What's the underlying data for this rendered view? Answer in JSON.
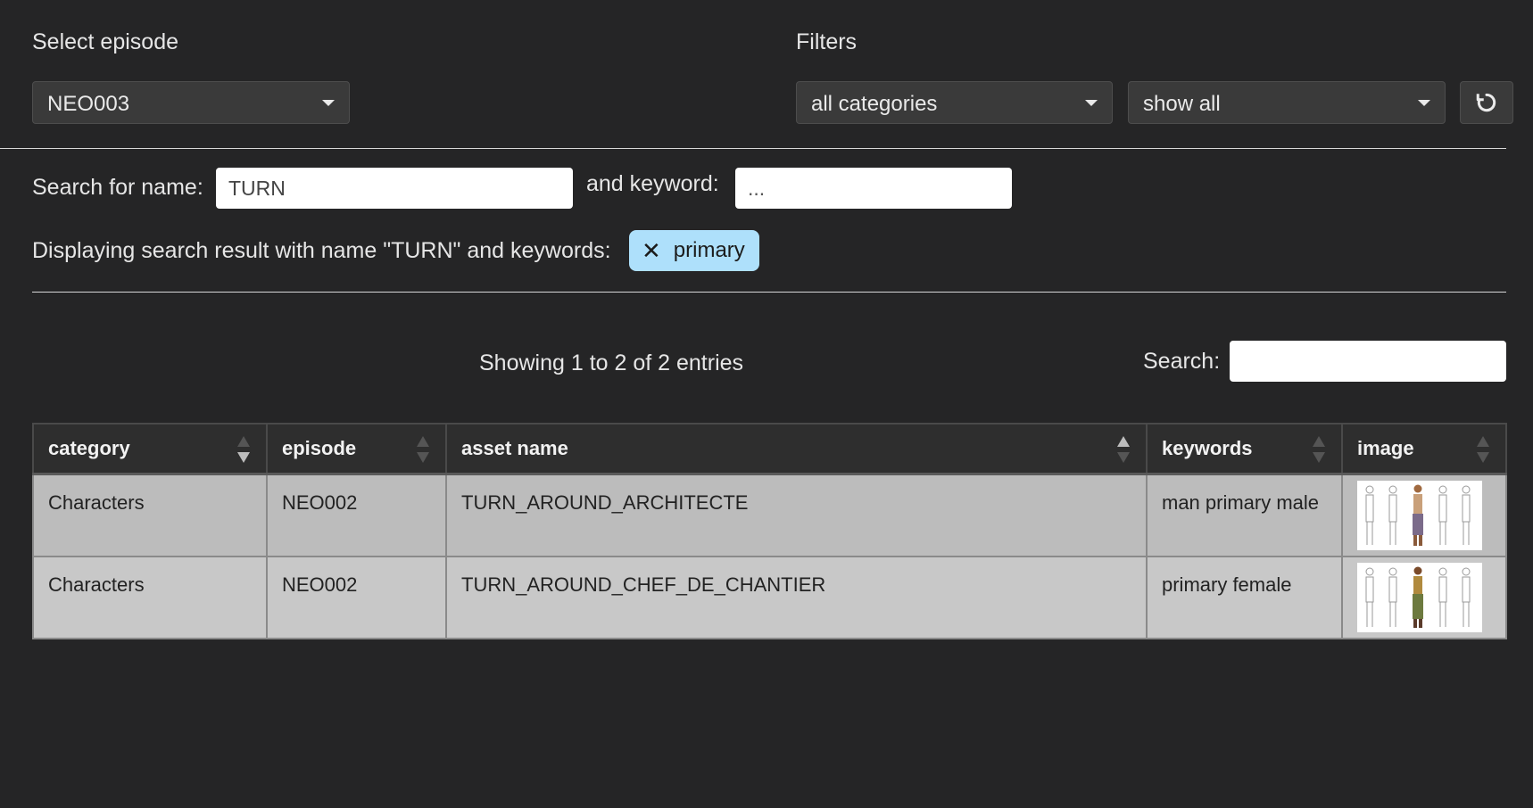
{
  "episode_selector": {
    "label": "Select episode",
    "value": "NEO003"
  },
  "filters": {
    "label": "Filters",
    "category_value": "all categories",
    "show_value": "show all",
    "reset_icon": "refresh-icon"
  },
  "search": {
    "name_label": "Search for name:",
    "name_value": "TURN",
    "keyword_label": "and keyword:",
    "keyword_placeholder": "...",
    "result_text": "Displaying search result with name \"TURN\" and keywords:",
    "chips": [
      {
        "remove": "✕",
        "label": "primary"
      }
    ]
  },
  "table_controls": {
    "info": "Showing 1 to 2 of 2 entries",
    "search_label": "Search:",
    "search_value": ""
  },
  "table": {
    "columns": [
      "category",
      "episode",
      "asset name",
      "keywords",
      "image"
    ],
    "rows": [
      {
        "category": "Characters",
        "episode": "NEO002",
        "asset_name": "TURN_AROUND_ARCHITECTE",
        "keywords": "man primary male",
        "image_icon": "character-turnaround-thumbnail"
      },
      {
        "category": "Characters",
        "episode": "NEO002",
        "asset_name": "TURN_AROUND_CHEF_DE_CHANTIER",
        "keywords": "primary female",
        "image_icon": "character-turnaround-thumbnail"
      }
    ]
  },
  "colors": {
    "background": "#252526",
    "chip_background": "#aee0fb",
    "row_odd": "#bcbcbc",
    "row_even": "#c8c8c8"
  }
}
